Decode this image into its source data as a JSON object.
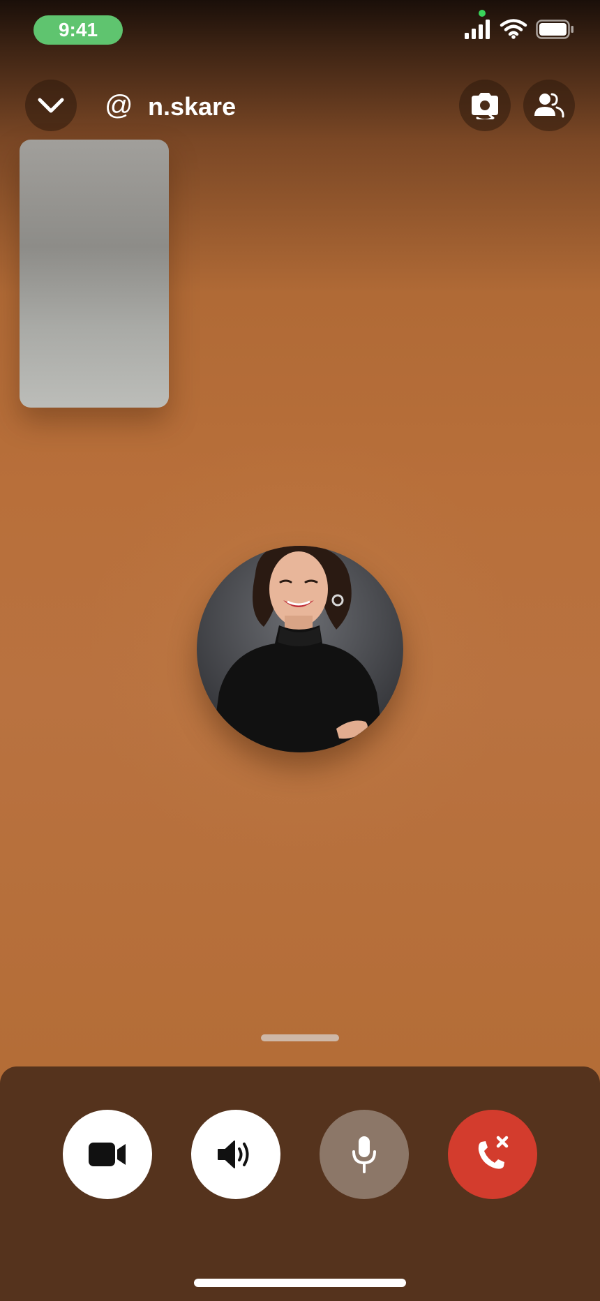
{
  "status_bar": {
    "time": "9:41",
    "icons": [
      "signal-icon",
      "wifi-icon",
      "battery-icon"
    ],
    "time_pill_color": "#5fc46f"
  },
  "header": {
    "at_symbol": "@",
    "username": "n.skare",
    "left_icon": "chevron-down-icon",
    "right_icons": [
      "camera-flip-icon",
      "people-icon"
    ]
  },
  "call": {
    "avatar": "contact-avatar",
    "self_preview": "self-video-preview"
  },
  "controls": {
    "buttons": [
      {
        "name": "video",
        "icon": "video-camera-icon",
        "color": "#ffffff"
      },
      {
        "name": "speaker",
        "icon": "speaker-icon",
        "color": "#ffffff"
      },
      {
        "name": "microphone",
        "icon": "microphone-icon",
        "color": "#8c7768"
      },
      {
        "name": "end-call",
        "icon": "end-call-icon",
        "color": "#d33c2d"
      }
    ]
  },
  "colors": {
    "background": "#b86f3a",
    "panel": "#55331d"
  }
}
